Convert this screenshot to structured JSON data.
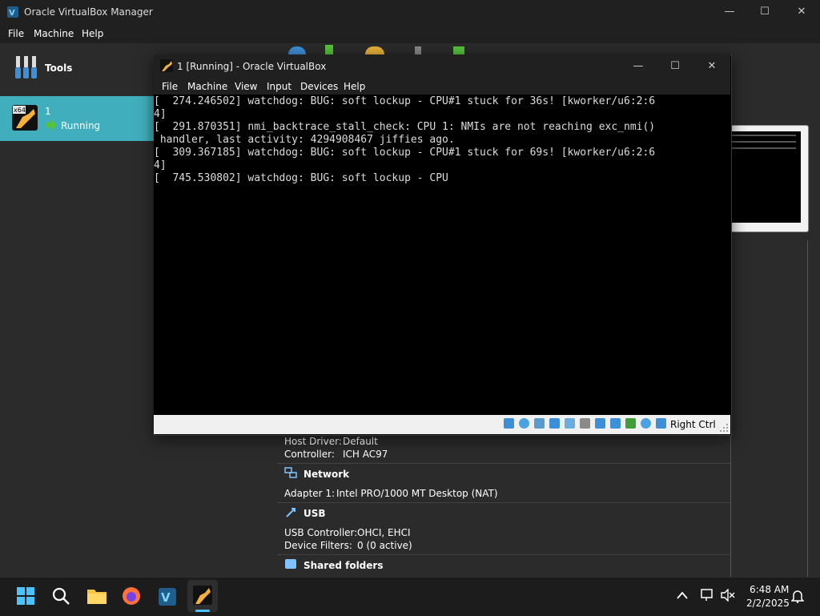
{
  "manager": {
    "title": "Oracle VirtualBox Manager",
    "menu": [
      "File",
      "Machine",
      "Help"
    ],
    "window_controls": [
      "—",
      "☐",
      "✕"
    ],
    "tools_label": "Tools",
    "vm": {
      "name": "1",
      "state": "Running",
      "badge": "x64"
    }
  },
  "details": {
    "audio": {
      "host_driver_label": "Host Driver:",
      "host_driver": "Default",
      "controller_label": "Controller:",
      "controller": "ICH AC97"
    },
    "network": {
      "heading": "Network",
      "adapter_label": "Adapter 1:",
      "adapter": "Intel PRO/1000 MT Desktop (NAT)"
    },
    "usb": {
      "heading": "USB",
      "controller_label": "USB Controller:",
      "controller": "OHCI, EHCI",
      "filters_label": "Device Filters:",
      "filters": "0 (0 active)"
    },
    "shared": {
      "heading": "Shared folders"
    }
  },
  "vm_window": {
    "title": "1 [Running] - Oracle VirtualBox",
    "menu": [
      "File",
      "Machine",
      "View",
      "Input",
      "Devices",
      "Help"
    ],
    "window_controls": [
      "—",
      "☐",
      "✕"
    ],
    "console_lines": [
      "[  274.246502] watchdog: BUG: soft lockup - CPU#1 stuck for 36s! [kworker/u6:2:6",
      "4]",
      "[  291.870351] nmi_backtrace_stall_check: CPU 1: NMIs are not reaching exc_nmi()",
      " handler, last activity: 4294908467 jiffies ago.",
      "[  309.367185] watchdog: BUG: soft lockup - CPU#1 stuck for 69s! [kworker/u6:2:6",
      "4]",
      "[  745.530802] watchdog: BUG: soft lockup - CPU"
    ],
    "host_key": "Right Ctrl"
  },
  "taskbar": {
    "time": "6:48 AM",
    "date": "2/2/2025"
  },
  "colors": {
    "accent": "#41aebd",
    "dark": "#202020",
    "console_text": "#dcdcdc"
  }
}
